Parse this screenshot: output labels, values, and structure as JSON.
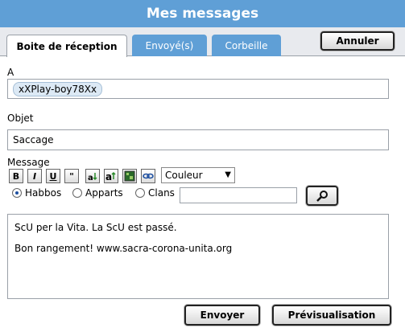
{
  "window": {
    "title": "Mes messages"
  },
  "tabs": [
    {
      "label": "Boite de réception",
      "active": true
    },
    {
      "label": "Envoyé(s)",
      "active": false
    },
    {
      "label": "Corbeille",
      "active": false
    }
  ],
  "buttons": {
    "close": "Annuler",
    "send": "Envoyer",
    "preview": "Prévisualisation"
  },
  "to": {
    "label": "A",
    "recipient": "xXPlay-boy78Xx"
  },
  "subject": {
    "label": "Objet",
    "value": "Saccage"
  },
  "message": {
    "label": "Message",
    "line1": "ScU per la Vita. La ScU est passé.",
    "line2": "Bon rangement! www.sacra-corona-unita.org"
  },
  "toolbar": {
    "bold": "B",
    "italic": "I",
    "underline": "U",
    "quote": "\"",
    "color_select": "Couleur"
  },
  "search": {
    "options": [
      {
        "label": "Habbos",
        "checked": true
      },
      {
        "label": "Apparts",
        "checked": false
      },
      {
        "label": "Clans",
        "checked": false
      }
    ],
    "value": ""
  },
  "colors": {
    "accent": "#5f9fd6",
    "panel": "#e8eaee"
  }
}
